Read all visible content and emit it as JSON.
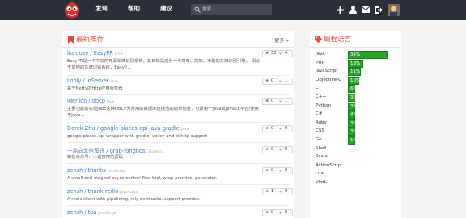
{
  "nav": {
    "links": [
      "发现",
      "帮助",
      "建议"
    ],
    "search_placeholder": "搜索"
  },
  "left_panel": {
    "title": "最新推荐",
    "more": "更多 »",
    "repos": [
      {
        "title": "liuruoze / EasyPR",
        "lang": "C++",
        "desc": "EasyPR是一个中文的开源车牌识别系统，其目标是成为一个简单、高效、准确的车牌识别引擎。 相比于其他的车牌识别系统，EasyP...",
        "stars": "33",
        "forks": "4"
      },
      {
        "title": "Looly / IoServer",
        "lang": "Java",
        "desc": "基于Netty的Http应用服务器",
        "stars": "0",
        "forks": "1"
      },
      {
        "title": "idenion / dbcp",
        "lang": "Java",
        "desc": "主要功能是实现Jdbc这种DBCP为常用的数据库连接池的简单包装，可适用于Java或JavaEE平台(使用于Java...",
        "stars": "0",
        "forks": "1"
      },
      {
        "title": "Derek Zhu / google-places-api-java-gradle",
        "lang": "Java",
        "desc": "google places api wrapper with gradle, volley and okhttp support",
        "stars": "0",
        "forks": "0"
      },
      {
        "title": "一路向北也蛮好 / grab-fonghost",
        "lang": "Node.js",
        "desc": "微信公众号：小说搜搜的源码",
        "stars": "0",
        "forks": "0"
      },
      {
        "title": "zensh / thunks",
        "lang": "JavaScript",
        "desc": "A small and magical async control flow tool, wrap promise, generator.",
        "stars": "0",
        "forks": "0"
      },
      {
        "title": "zensh / thunk-redis",
        "lang": "JavaScript",
        "desc": "A redis client with pipelining, rely on thunks, support promise.",
        "stars": "1",
        "forks": "0"
      },
      {
        "title": "zensh / toa",
        "lang": "JavaScript",
        "desc": "",
        "stars": "0",
        "forks": "0"
      }
    ]
  },
  "right_panel": {
    "title": "编程语言",
    "languages": [
      {
        "name": "Java",
        "pct": "34%",
        "value": 34
      },
      {
        "name": "PHP",
        "pct": "13%",
        "value": 13
      },
      {
        "name": "JavaScript",
        "pct": "11%",
        "value": 11
      },
      {
        "name": "Objective-C",
        "pct": "10%",
        "value": 10
      },
      {
        "name": "C",
        "pct": "6%",
        "value": 6
      },
      {
        "name": "C++",
        "pct": "3%",
        "value": 3
      },
      {
        "name": "Python",
        "pct": "3%",
        "value": 3
      },
      {
        "name": "C#",
        "pct": "4%",
        "value": 4
      },
      {
        "name": "Ruby",
        "pct": "3%",
        "value": 3
      },
      {
        "name": "CSS",
        "pct": "3%",
        "value": 3
      },
      {
        "name": "Go",
        "pct": "1%",
        "value": 1
      },
      {
        "name": "Shell",
        "pct": "",
        "value": 0
      },
      {
        "name": "Scala",
        "pct": "",
        "value": 0
      },
      {
        "name": "ActionScript",
        "pct": "",
        "value": 0
      },
      {
        "name": "Lua",
        "pct": "",
        "value": 0
      },
      {
        "name": "VimL",
        "pct": "",
        "value": 0
      }
    ]
  }
}
